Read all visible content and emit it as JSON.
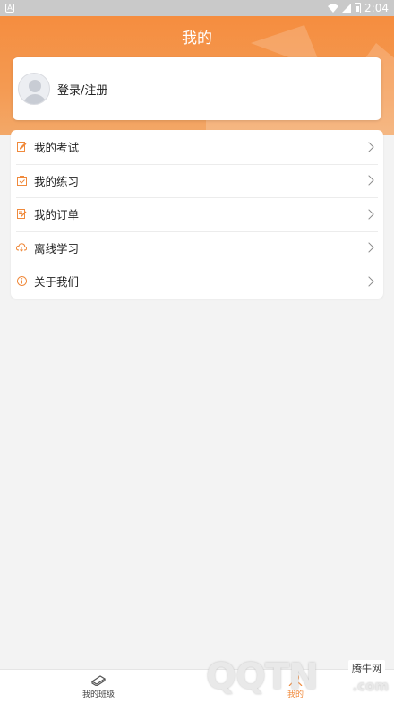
{
  "statusbar": {
    "left_badge": "A",
    "time": "2:04"
  },
  "header": {
    "title": "我的"
  },
  "login": {
    "label": "登录/注册"
  },
  "menu": {
    "items": [
      {
        "label": "我的考试",
        "icon": "exam-edit-icon"
      },
      {
        "label": "我的练习",
        "icon": "practice-icon"
      },
      {
        "label": "我的订单",
        "icon": "order-icon"
      },
      {
        "label": "离线学习",
        "icon": "cloud-download-icon"
      },
      {
        "label": "关于我们",
        "icon": "info-icon"
      }
    ]
  },
  "bottom_nav": {
    "tabs": [
      {
        "label": "我的班级",
        "icon": "book-icon",
        "active": false
      },
      {
        "label": "我的",
        "icon": "user-icon",
        "active": true
      }
    ]
  },
  "watermark": {
    "tag": "腾牛网",
    "logo": "QQTN",
    "suffix": ".com"
  },
  "colors": {
    "accent": "#f58d3f",
    "icon_orange": "#f08a3c"
  }
}
